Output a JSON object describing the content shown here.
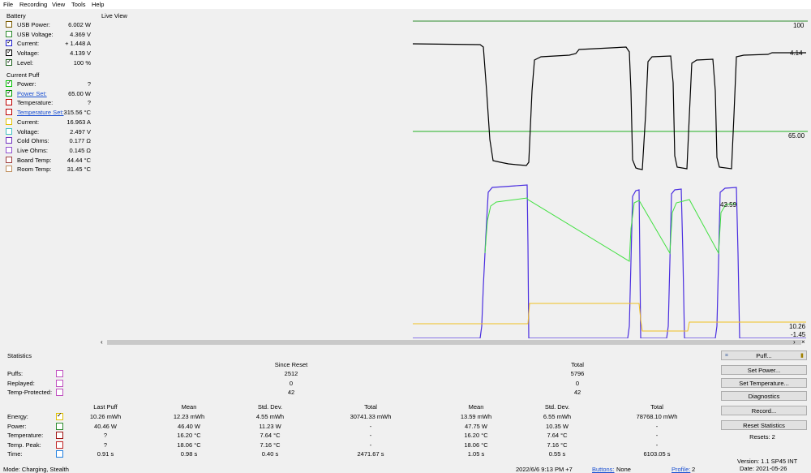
{
  "menu": [
    "File",
    "Recording",
    "View",
    "Tools",
    "Help"
  ],
  "battery": {
    "title": "Battery",
    "rows": [
      {
        "label": "USB Power:",
        "value": "6.002 W",
        "color": "#7a5a00",
        "checked": false,
        "link": false
      },
      {
        "label": "USB Voltage:",
        "value": "4.369 V",
        "color": "#2e8b2e",
        "checked": false,
        "link": false
      },
      {
        "label": "Current:",
        "value": "+ 1.448 A",
        "color": "#1f1fd0",
        "checked": true,
        "link": false
      },
      {
        "label": "Voltage:",
        "value": "4.139 V",
        "color": "#000000",
        "checked": true,
        "link": false
      },
      {
        "label": "Level:",
        "value": "100 %",
        "color": "#1b5e1b",
        "checked": true,
        "link": false
      }
    ]
  },
  "current_puff": {
    "title": "Current Puff",
    "rows": [
      {
        "label": "Power:",
        "value": "?",
        "color": "#00c000",
        "checked": true,
        "link": false
      },
      {
        "label": "Power Set:",
        "value": "65.00 W",
        "color": "#00a000",
        "checked": true,
        "link": true
      },
      {
        "label": "Temperature:",
        "value": "?",
        "color": "#c00000",
        "checked": false,
        "link": false
      },
      {
        "label": "Temperature Set:",
        "value": "315.56 °C",
        "color": "#c00000",
        "checked": false,
        "link": true
      },
      {
        "label": "Current:",
        "value": "16.963 A",
        "color": "#e0c000",
        "checked": false,
        "link": false
      },
      {
        "label": "Voltage:",
        "value": "2.497 V",
        "color": "#40c0c0",
        "checked": false,
        "link": false
      },
      {
        "label": "Cold Ohms:",
        "value": "0.177 Ω",
        "color": "#7030c0",
        "checked": false,
        "link": false
      },
      {
        "label": "Live Ohms:",
        "value": "0.145 Ω",
        "color": "#9050d0",
        "checked": false,
        "link": false
      },
      {
        "label": "Board Temp:",
        "value": "44.44 °C",
        "color": "#a04040",
        "checked": false,
        "link": false
      },
      {
        "label": "Room Temp:",
        "value": "31.45 °C",
        "color": "#c09060",
        "checked": false,
        "link": false
      }
    ]
  },
  "live_view": {
    "title": "Live View",
    "labels": {
      "level": "100",
      "voltage": "4.14",
      "power_set": "65.00",
      "power": "43.59",
      "current_low": "10.26",
      "current_neg": "-1.45"
    },
    "colors": {
      "level": "#2e8b2e",
      "voltage": "#000000",
      "power_set": "#22b022",
      "current": "#4a2ee0",
      "power": "#40e040",
      "amber": "#f0c020"
    }
  },
  "statistics": {
    "title": "Statistics",
    "since_reset_label": "Since Reset",
    "total_label": "Total",
    "counts": [
      {
        "label": "Puffs:",
        "since": "2512",
        "total": "5796"
      },
      {
        "label": "Replayed:",
        "since": "0",
        "total": "0"
      },
      {
        "label": "Temp-Protected:",
        "since": "42",
        "total": "42"
      }
    ],
    "columns": [
      "Last Puff",
      "Mean",
      "Std. Dev.",
      "Total",
      "Mean",
      "Std. Dev.",
      "Total"
    ],
    "rows": [
      {
        "label": "Energy:",
        "color": "#e0c000",
        "checked": true,
        "vals": [
          "10.26 mWh",
          "12.23 mWh",
          "4.55 mWh",
          "30741.33 mWh",
          "13.59 mWh",
          "6.55 mWh",
          "78768.10 mWh"
        ]
      },
      {
        "label": "Power:",
        "color": "#2e8b2e",
        "checked": false,
        "vals": [
          "40.46 W",
          "46.40 W",
          "11.23 W",
          "-",
          "47.75 W",
          "10.35 W",
          "-"
        ]
      },
      {
        "label": "Temperature:",
        "color": "#a01010",
        "checked": false,
        "vals": [
          "?",
          "16.20 °C",
          "7.64 °C",
          "-",
          "16.20 °C",
          "7.64 °C",
          "-"
        ]
      },
      {
        "label": "Temp. Peak:",
        "color": "#c02020",
        "checked": false,
        "vals": [
          "?",
          "18.06 °C",
          "7.16 °C",
          "-",
          "18.06 °C",
          "7.16 °C",
          "-"
        ]
      },
      {
        "label": "Time:",
        "color": "#2080e0",
        "checked": false,
        "vals": [
          "0.91 s",
          "0.98 s",
          "0.40 s",
          "2471.67 s",
          "1.05 s",
          "0.55 s",
          "6103.05 s"
        ]
      }
    ]
  },
  "buttons": {
    "puff": "Puff...",
    "set_power": "Set Power...",
    "set_temperature": "Set Temperature...",
    "diagnostics": "Diagnostics",
    "record": "Record...",
    "reset_statistics": "Reset Statistics",
    "resets": "Resets: 2"
  },
  "version": {
    "version": "Version: 1.1 SP45 INT",
    "date": "Date: 2021-05-26"
  },
  "status": {
    "mode": "Mode: Charging, Stealth",
    "datetime": "2022/6/6 9:13 PM +7",
    "buttons_label": "Buttons:",
    "buttons_value": "None",
    "profile_label": "Profile:",
    "profile_value": "2"
  }
}
